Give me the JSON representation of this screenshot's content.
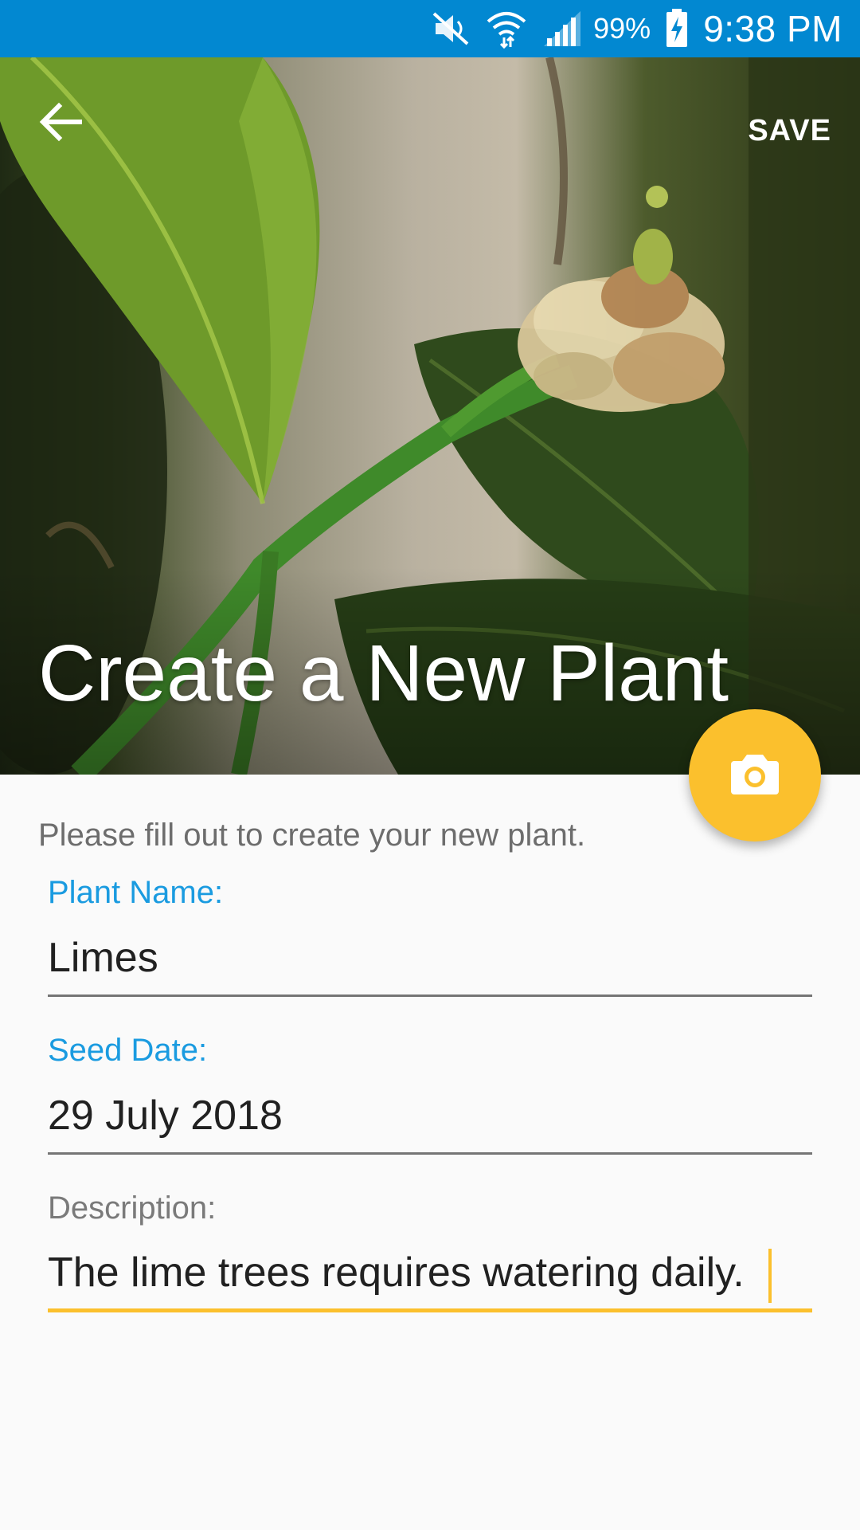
{
  "status_bar": {
    "battery_percent": "99%",
    "time": "9:38 PM",
    "icons": [
      "mute-icon",
      "wifi-icon",
      "signal-icon",
      "battery-charging-icon"
    ]
  },
  "header": {
    "title": "Create a New Plant",
    "save_label": "SAVE",
    "back_icon": "arrow-back-icon"
  },
  "fab": {
    "icon": "camera-icon",
    "color": "#fbc02d"
  },
  "form": {
    "intro": "Please fill out to create your new plant.",
    "plant_name": {
      "label": "Plant Name:",
      "value": "Limes"
    },
    "seed_date": {
      "label": "Seed Date:",
      "value": "29 July 2018"
    },
    "description": {
      "label": "Description:",
      "value": "The lime trees requires watering daily."
    }
  },
  "colors": {
    "status_bar": "#0288d1",
    "accent": "#fbc02d",
    "label_active": "#1a9be0"
  }
}
